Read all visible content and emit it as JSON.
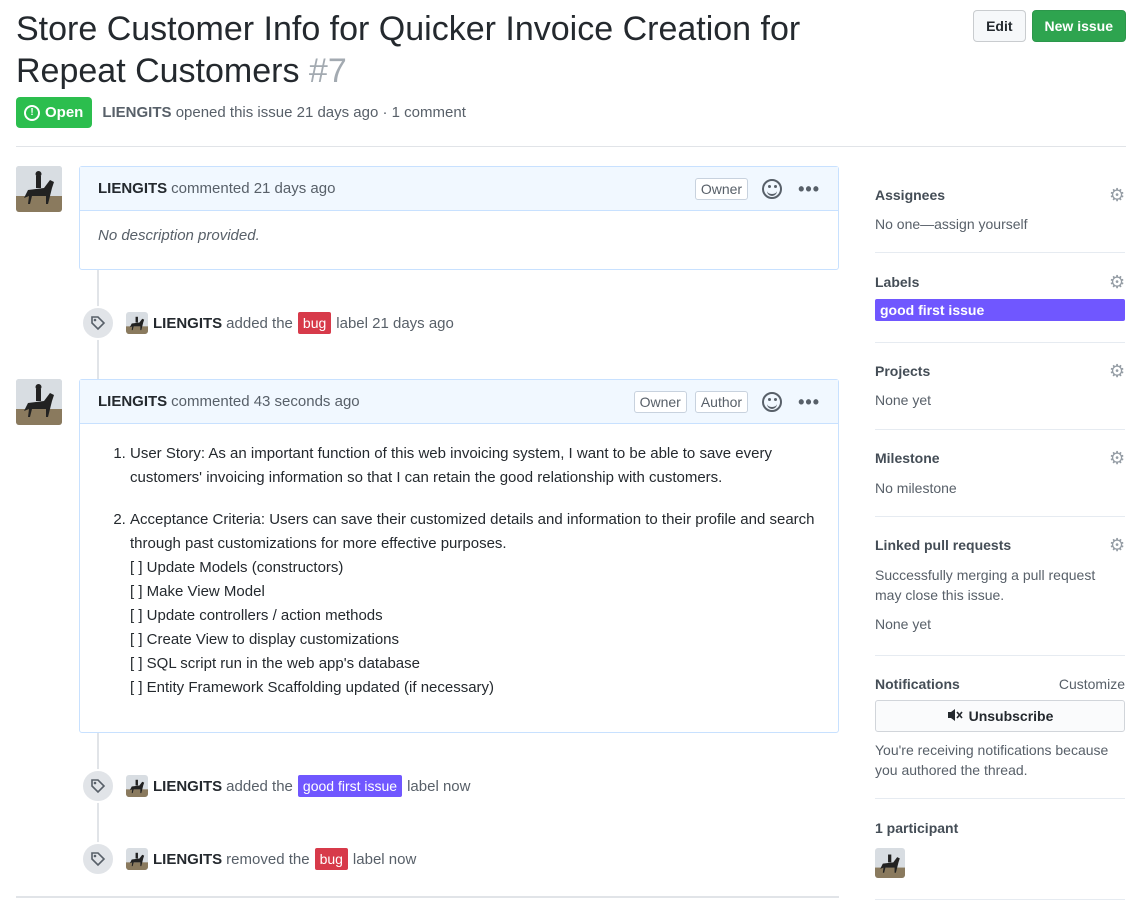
{
  "issue": {
    "title": "Store Customer Info for Quicker Invoice Creation for Repeat Customers",
    "number": "#7",
    "state": "Open",
    "author": "LIENGITS",
    "opened_text": "opened this issue 21 days ago · 1 comment"
  },
  "header_actions": {
    "edit_label": "Edit",
    "new_label": "New issue"
  },
  "comments": [
    {
      "author": "LIENGITS",
      "when": "commented 21 days ago",
      "roles": [
        "Owner"
      ],
      "body_empty": "No description provided."
    },
    {
      "author": "LIENGITS",
      "when": "commented 43 seconds ago",
      "roles": [
        "Owner",
        "Author"
      ],
      "item1": "User Story: As an important function of this web invoicing system, I want to be able to save every customers' invoicing information so that I can retain the good relationship with customers.",
      "item2_intro": "Acceptance Criteria: Users can save their customized details and information to their profile and search through past customizations for more effective purposes.",
      "tasks": [
        "[ ] Update Models (constructors)",
        "[ ] Make View Model",
        "[ ] Update controllers / action methods",
        "[ ] Create View to display customizations",
        "[ ] SQL script run in the web app's database",
        "[ ] Entity Framework Scaffolding updated (if necessary)"
      ]
    }
  ],
  "events": [
    {
      "actor": "LIENGITS",
      "action": "added the",
      "label": "bug",
      "suffix": "label 21 days ago"
    },
    {
      "actor": "LIENGITS",
      "action": "added the",
      "label": "good first issue",
      "suffix": "label now"
    },
    {
      "actor": "LIENGITS",
      "action": "removed the",
      "label": "bug",
      "suffix": "label now"
    }
  ],
  "sidebar": {
    "assignees": {
      "title": "Assignees",
      "value": "No one—assign yourself"
    },
    "labels": {
      "title": "Labels",
      "value": "good first issue"
    },
    "projects": {
      "title": "Projects",
      "value": "None yet"
    },
    "milestone": {
      "title": "Milestone",
      "value": "No milestone"
    },
    "linked_prs": {
      "title": "Linked pull requests",
      "note": "Successfully merging a pull request may close this issue.",
      "value": "None yet"
    },
    "notifications": {
      "title": "Notifications",
      "customize": "Customize",
      "button": "Unsubscribe",
      "note": "You're receiving notifications because you authored the thread."
    },
    "participants": {
      "title": "1 participant"
    }
  },
  "colors": {
    "open_green": "#2cbe4e",
    "bug_label": "#d73a4a",
    "good_first_issue_label": "#7057ff",
    "new_issue_green": "#2ea44f"
  },
  "icons": [
    "info-circle-icon",
    "tag-icon",
    "smiley-icon",
    "kebab-icon",
    "gear-icon",
    "mute-icon"
  ]
}
